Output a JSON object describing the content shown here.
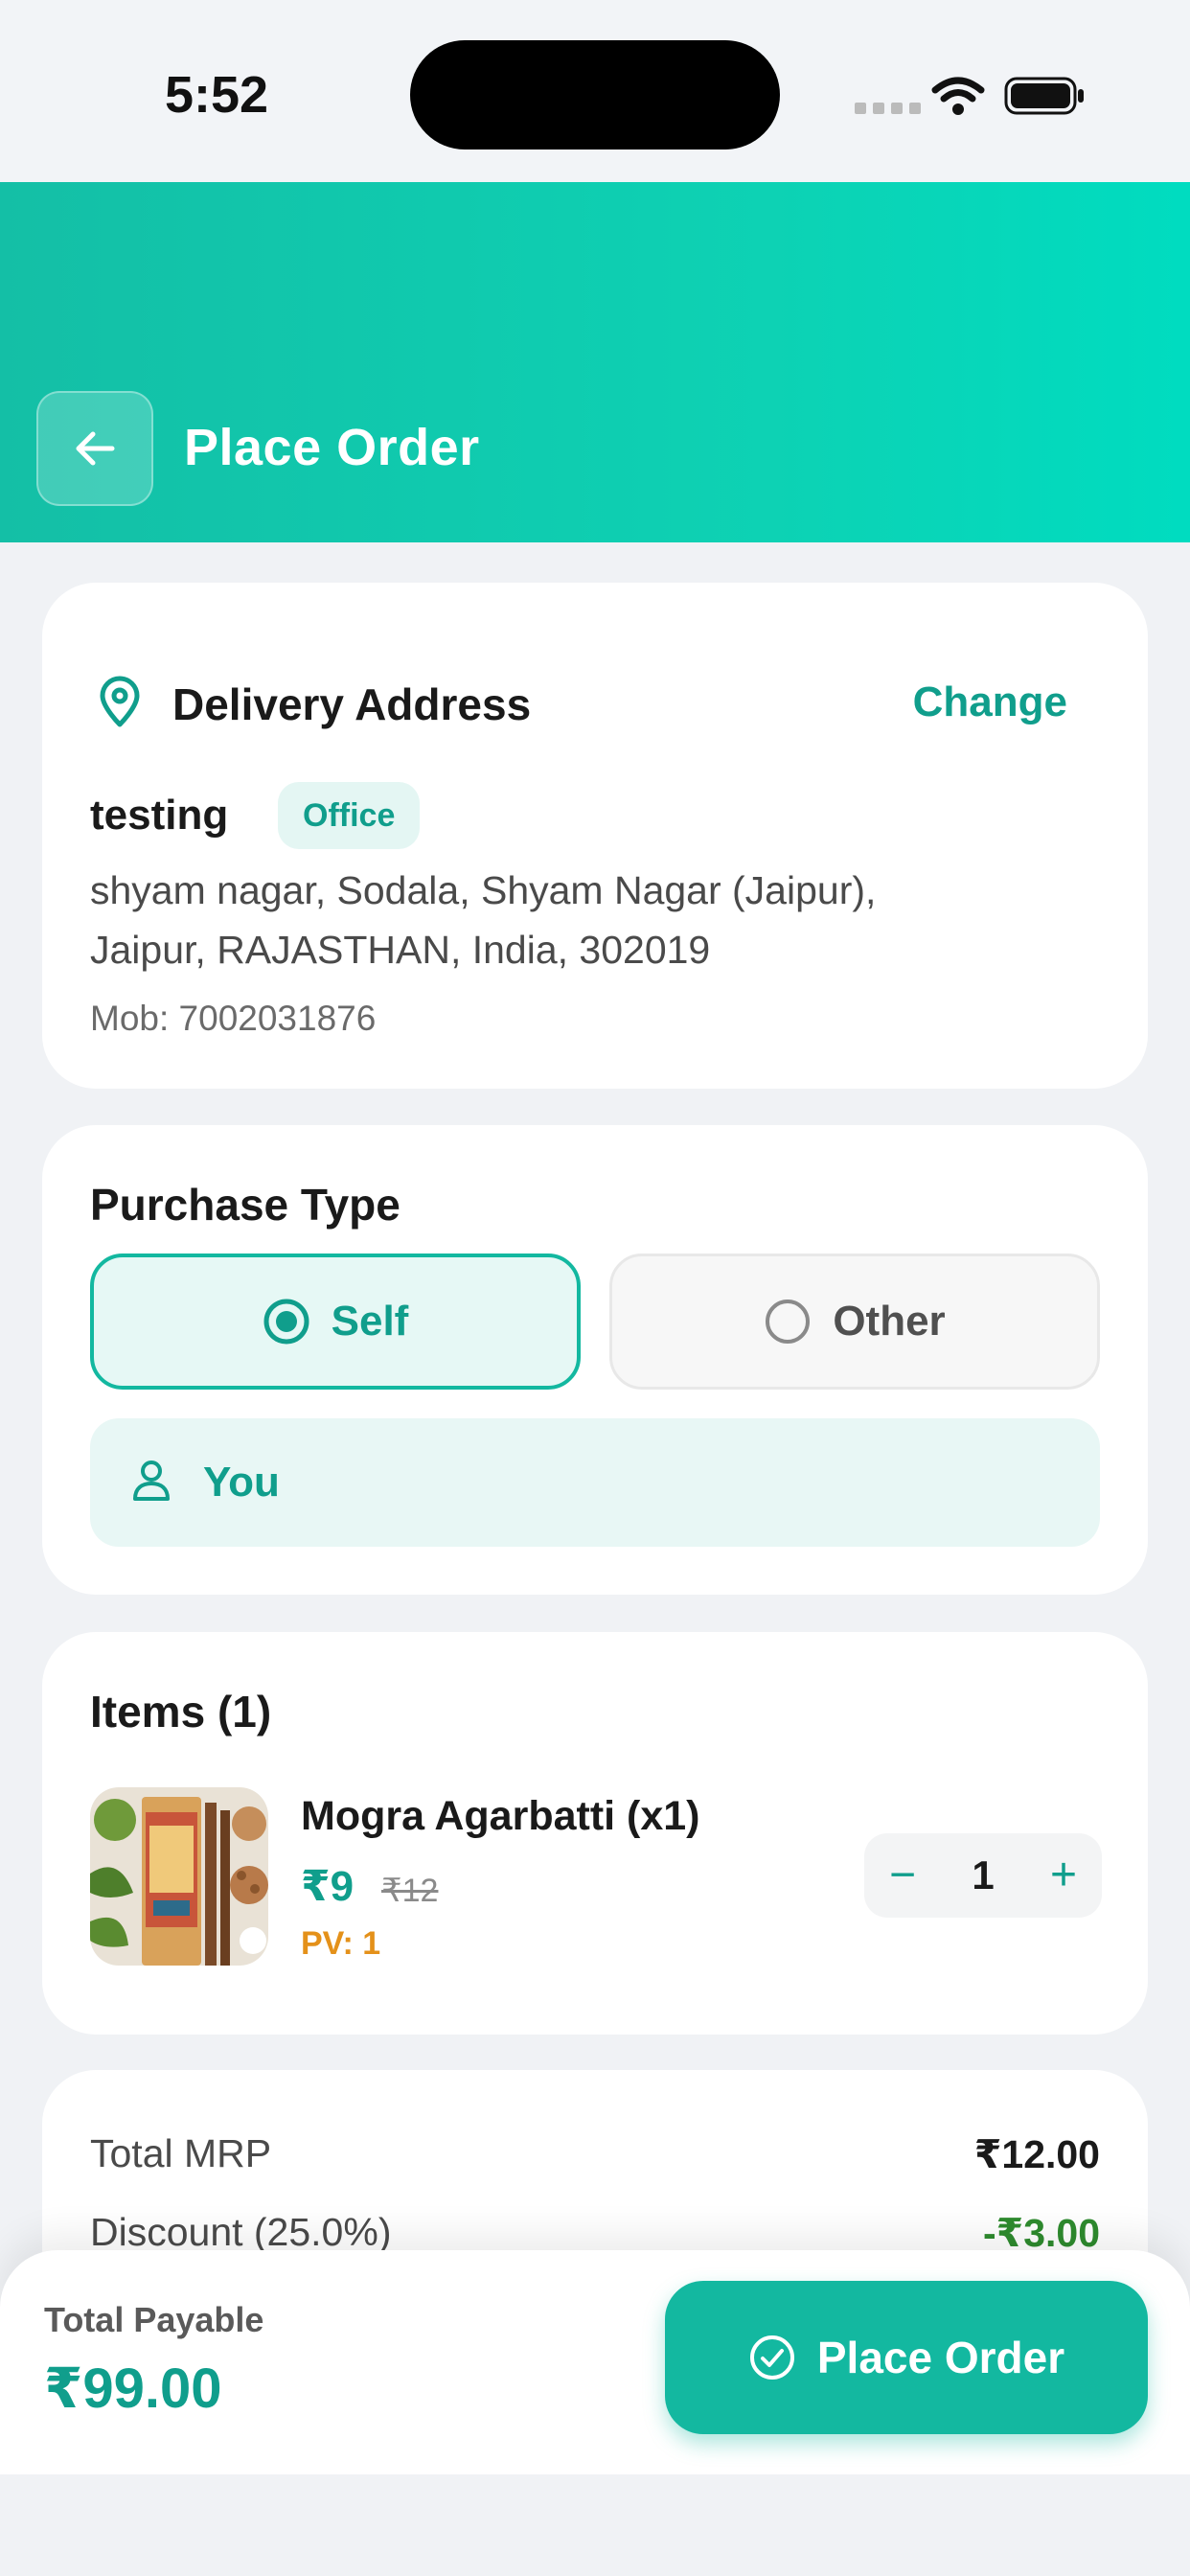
{
  "status_bar": {
    "time": "5:52"
  },
  "header": {
    "title": "Place Order",
    "accent": "#13b8a0"
  },
  "address": {
    "heading": "Delivery Address",
    "change_label": "Change",
    "name": "testing",
    "tag": "Office",
    "line1": "shyam nagar, Sodala, Shyam Nagar  (Jaipur),",
    "line2": "Jaipur, RAJASTHAN, India, 302019",
    "mobile": "Mob: 7002031876"
  },
  "purchase_type": {
    "title": "Purchase Type",
    "options": [
      {
        "label": "Self",
        "selected": true
      },
      {
        "label": "Other",
        "selected": false
      }
    ],
    "recipient": "You"
  },
  "items": {
    "title": "Items (1)",
    "list": [
      {
        "name": "Mogra Agarbatti (x1)",
        "price": "₹9",
        "mrp": "₹12",
        "pv": "PV: 1",
        "quantity": "1"
      }
    ]
  },
  "summary": {
    "rows": [
      {
        "label": "Total MRP",
        "value": "₹12.00"
      },
      {
        "label": "Discount (25.0%)",
        "value": "-₹3.00"
      }
    ]
  },
  "footer": {
    "total_label": "Total Payable",
    "total_value": "₹99.00",
    "button_label": "Place Order"
  }
}
